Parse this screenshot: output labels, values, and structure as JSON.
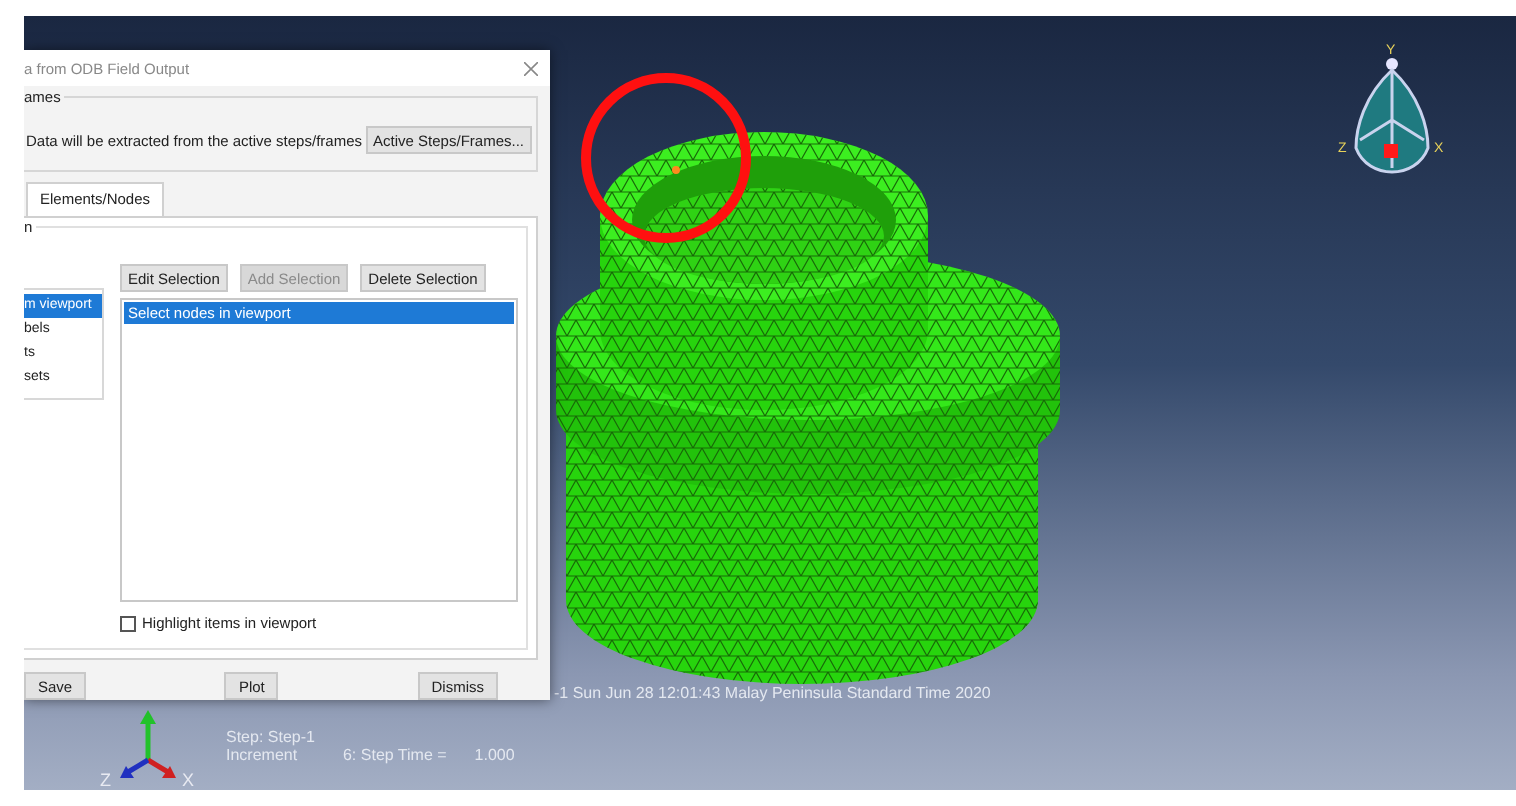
{
  "dialog": {
    "title": "a from ODB Field Output",
    "frames_group": {
      "label": "ames",
      "note": "Data will be extracted from the active steps/frames",
      "button": "Active Steps/Frames..."
    },
    "tabs": [
      {
        "label": "Elements/Nodes",
        "selected": true
      }
    ],
    "method_label": "n",
    "methods": [
      {
        "label": "m viewport",
        "selected": true
      },
      {
        "label": "bels",
        "selected": false
      },
      {
        "label": "ts",
        "selected": false
      },
      {
        "label": "sets",
        "selected": false
      }
    ],
    "selection_buttons": [
      {
        "label": "Edit Selection",
        "disabled": false
      },
      {
        "label": "Add Selection",
        "disabled": true
      },
      {
        "label": "Delete Selection",
        "disabled": false
      }
    ],
    "selection_list": [
      {
        "label": "Select nodes in viewport",
        "selected": true
      }
    ],
    "highlight": {
      "label": "Highlight items in viewport",
      "checked": false
    },
    "buttons": [
      "Save",
      "Plot",
      "Dismiss"
    ]
  },
  "viewport": {
    "title_line": "-1   Sun Jun 28 12:01:43 Malay Peninsula Standard Time 2020",
    "step_label": "Step: Step-1",
    "increment_label": "Increment",
    "increment_value": "6: Step Time =",
    "time_value": "1.000",
    "triad_labels": {
      "z": "Z",
      "x": "X"
    },
    "view_cube_labels": {
      "y": "Y",
      "z": "Z",
      "x": "X"
    }
  }
}
